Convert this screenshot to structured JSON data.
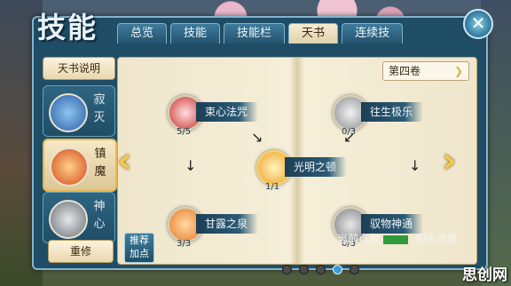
{
  "window": {
    "title": "技能"
  },
  "tabs": [
    {
      "label": "总览"
    },
    {
      "label": "技能"
    },
    {
      "label": "技能栏"
    },
    {
      "label": "天书",
      "active": true
    },
    {
      "label": "连续技"
    }
  ],
  "sidebar": {
    "info_button": "天书说明",
    "items": [
      {
        "label": "寂灭",
        "icon": "buddha-icon",
        "color": "#4a8fd0"
      },
      {
        "label": "镇魔",
        "icon": "flame-icon",
        "color": "#e06a2a",
        "active": true
      },
      {
        "label": "神心",
        "icon": "spirit-icon",
        "color": "#9aa0a6"
      }
    ],
    "reset_button": "重修"
  },
  "book": {
    "volume": "第四卷",
    "skills": [
      {
        "name": "束心法咒",
        "count": "5/5",
        "icon": "lotus-icon",
        "color": "#c9302c"
      },
      {
        "name": "光明之顿",
        "count": "1/1",
        "icon": "sun-icon",
        "color": "#f0a020"
      },
      {
        "name": "甘露之泉",
        "count": "3/3",
        "icon": "flame-icon",
        "color": "#e87a2a"
      },
      {
        "name": "往生极乐",
        "count": "0/3",
        "icon": "ghost-icon",
        "color": "#8a8e90"
      },
      {
        "name": "驭物神通",
        "count": "0/3",
        "icon": "blade-icon",
        "color": "#7c8084"
      }
    ],
    "pages": 5,
    "current_page": 4
  },
  "recommend_button": "推荐加点",
  "status": {
    "current_points_label": "当前点数",
    "remaining_points_label": "剩余点数"
  },
  "watermark": "思创网"
}
